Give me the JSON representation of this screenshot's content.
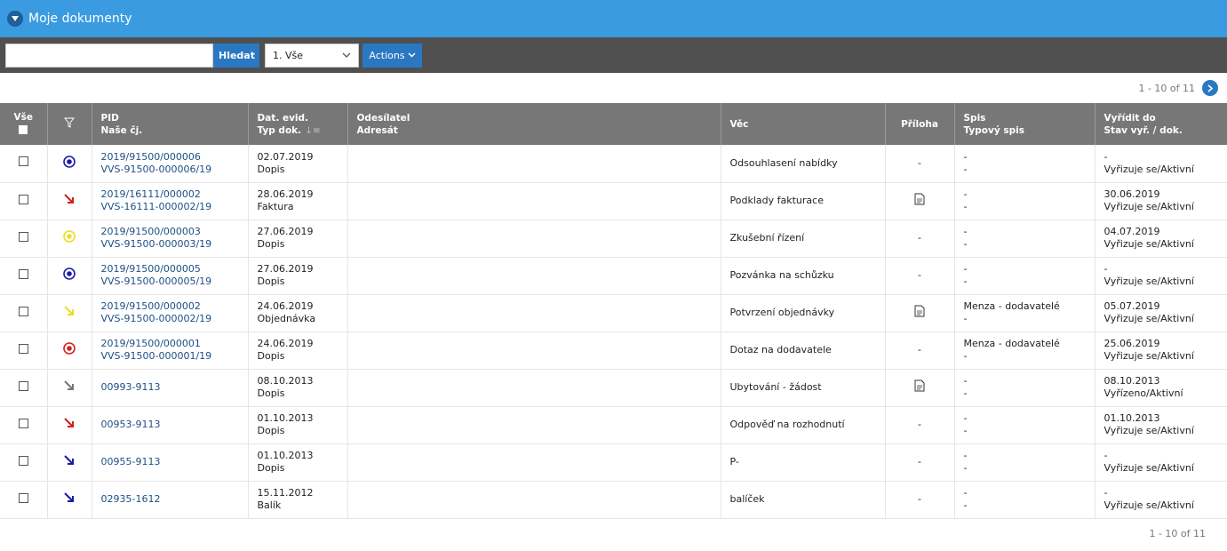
{
  "header": {
    "title": "Moje dokumenty"
  },
  "toolbar": {
    "search_value": "",
    "search_button": "Hledat",
    "filter_selected": "1. Vše",
    "actions_label": "Actions"
  },
  "pager": {
    "label": "1 - 10 of 11"
  },
  "table": {
    "columns": {
      "select_all": "Vše",
      "pid": "PID",
      "nase_cj": "Naše čj.",
      "dat_evid": "Dat. evid.",
      "typ_dok": "Typ dok.",
      "odesilatel": "Odesílatel",
      "adresat": "Adresát",
      "vec": "Věc",
      "priloha": "Příloha",
      "spis": "Spis",
      "typovy_spis": "Typový spis",
      "vyridit": "Vyřídit do",
      "stav": "Stav vyř. / dok."
    },
    "rows": [
      {
        "icon": "circle-dot",
        "color": "#1a1aa8",
        "pid": "2019/91500/000006",
        "cj": "VVS-91500-000006/19",
        "date": "02.07.2019",
        "typ": "Dopis",
        "vec": "Odsouhlasení nabídky",
        "priloha": "-",
        "spis": "-",
        "typovy": "-",
        "vyridit": "-",
        "stav": "Vyřizuje se/Aktivní"
      },
      {
        "icon": "arrow",
        "color": "#d22020",
        "pid": "2019/16111/000002",
        "cj": "VVS-16111-000002/19",
        "date": "28.06.2019",
        "typ": "Faktura",
        "vec": "Podklady fakturace",
        "priloha": "doc",
        "spis": "-",
        "typovy": "-",
        "vyridit": "30.06.2019",
        "stav": "Vyřizuje se/Aktivní"
      },
      {
        "icon": "circle-dot",
        "color": "#e8e020",
        "pid": "2019/91500/000003",
        "cj": "VVS-91500-000003/19",
        "date": "27.06.2019",
        "typ": "Dopis",
        "vec": "Zkušební řízení",
        "priloha": "-",
        "spis": "-",
        "typovy": "-",
        "vyridit": "04.07.2019",
        "stav": "Vyřizuje se/Aktivní"
      },
      {
        "icon": "circle-dot",
        "color": "#1a1aa8",
        "pid": "2019/91500/000005",
        "cj": "VVS-91500-000005/19",
        "date": "27.06.2019",
        "typ": "Dopis",
        "vec": "Pozvánka na schůzku",
        "priloha": "-",
        "spis": "-",
        "typovy": "-",
        "vyridit": "-",
        "stav": "Vyřizuje se/Aktivní"
      },
      {
        "icon": "arrow",
        "color": "#e8e020",
        "pid": "2019/91500/000002",
        "cj": "VVS-91500-000002/19",
        "date": "24.06.2019",
        "typ": "Objednávka",
        "vec": "Potvrzení objednávky",
        "priloha": "doc",
        "spis": "Menza - dodavatelé",
        "typovy": "-",
        "vyridit": "05.07.2019",
        "stav": "Vyřizuje se/Aktivní"
      },
      {
        "icon": "circle-dot",
        "color": "#d22020",
        "pid": "2019/91500/000001",
        "cj": "VVS-91500-000001/19",
        "date": "24.06.2019",
        "typ": "Dopis",
        "vec": "Dotaz na dodavatele",
        "priloha": "-",
        "spis": "Menza - dodavatelé",
        "typovy": "-",
        "vyridit": "25.06.2019",
        "stav": "Vyřizuje se/Aktivní"
      },
      {
        "icon": "arrow",
        "color": "#777777",
        "pid": "00993-9113",
        "cj": "",
        "date": "08.10.2013",
        "typ": "Dopis",
        "vec": "Ubytování - žádost",
        "priloha": "doc",
        "spis": "-",
        "typovy": "-",
        "vyridit": "08.10.2013",
        "stav": "Vyřízeno/Aktivní"
      },
      {
        "icon": "arrow",
        "color": "#d22020",
        "pid": "00953-9113",
        "cj": "",
        "date": "01.10.2013",
        "typ": "Dopis",
        "vec": "Odpověď na rozhodnutí",
        "priloha": "-",
        "spis": "-",
        "typovy": "-",
        "vyridit": "01.10.2013",
        "stav": "Vyřizuje se/Aktivní"
      },
      {
        "icon": "arrow",
        "color": "#1a1aa8",
        "pid": "00955-9113",
        "cj": "",
        "date": "01.10.2013",
        "typ": "Dopis",
        "vec": "P-",
        "priloha": "-",
        "spis": "-",
        "typovy": "-",
        "vyridit": "-",
        "stav": "Vyřizuje se/Aktivní"
      },
      {
        "icon": "arrow",
        "color": "#1a1aa8",
        "pid": "02935-1612",
        "cj": "",
        "date": "15.11.2012",
        "typ": "Balík",
        "vec": "balíček",
        "priloha": "-",
        "spis": "-",
        "typovy": "-",
        "vyridit": "-",
        "stav": "Vyřizuje se/Aktivní"
      }
    ]
  }
}
